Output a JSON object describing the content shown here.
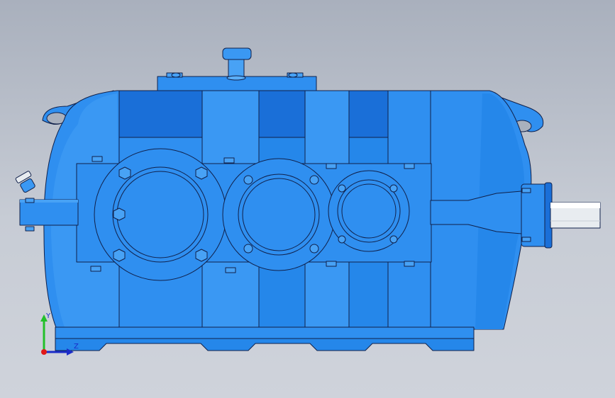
{
  "viewport": {
    "background_top": "#a9b0bd",
    "background_bottom": "#cfd3db"
  },
  "model": {
    "body_color": "#2f8ff0",
    "body_dark": "#1a6fd8",
    "body_light": "#48a2f5",
    "outline_color": "#10204a",
    "shaft_color": "#e8ecf0",
    "gears": [
      "large-bearing-cover",
      "middle-bearing-cover",
      "small-bearing-cover"
    ]
  },
  "triad": {
    "y_label": "Y",
    "z_label": "Z",
    "y_color": "#22c02a",
    "z_color": "#1a2cc8",
    "origin_color": "#e01818"
  }
}
